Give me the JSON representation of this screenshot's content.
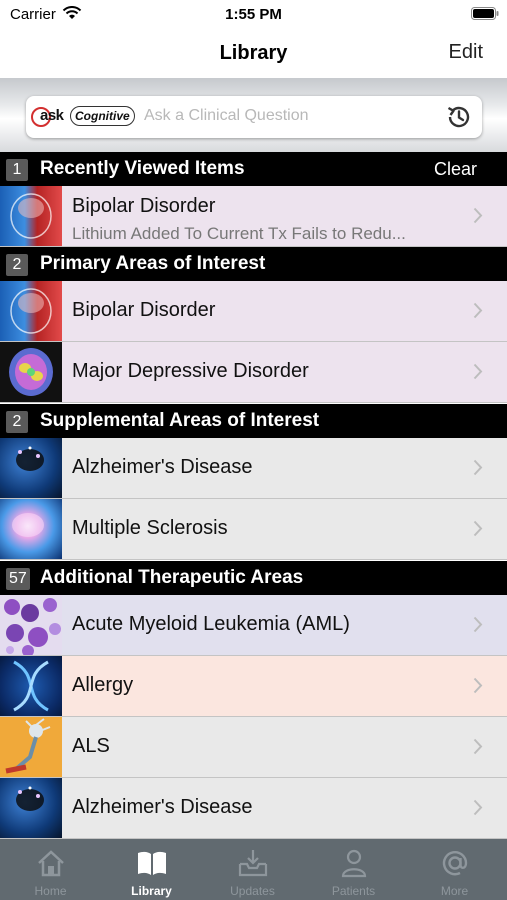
{
  "status_bar": {
    "carrier": "Carrier",
    "time": "1:55 PM"
  },
  "nav": {
    "title": "Library",
    "edit_label": "Edit"
  },
  "search": {
    "logo_ask": "ask",
    "logo_cognitive": "Cognitive",
    "placeholder": "Ask a Clinical Question"
  },
  "sections": [
    {
      "count": "1",
      "title": "Recently Viewed Items",
      "action": "Clear",
      "items": [
        {
          "title": "Bipolar Disorder",
          "subtitle": "Lithium Added To Current Tx Fails to Redu...",
          "icon": "brain-red-icon"
        }
      ]
    },
    {
      "count": "2",
      "title": "Primary Areas of Interest",
      "items": [
        {
          "title": "Bipolar Disorder",
          "icon": "brain-red-icon"
        },
        {
          "title": "Major Depressive Disorder",
          "icon": "brain-scan-icon"
        }
      ]
    },
    {
      "count": "2",
      "title": "Supplemental Areas of Interest",
      "items": [
        {
          "title": "Alzheimer's Disease",
          "icon": "head-blue-icon"
        },
        {
          "title": "Multiple Sclerosis",
          "icon": "brain-glow-icon"
        }
      ]
    },
    {
      "count": "57",
      "title": "Additional Therapeutic Areas",
      "items": [
        {
          "title": "Acute Myeloid Leukemia (AML)",
          "icon": "cells-icon"
        },
        {
          "title": "Allergy",
          "icon": "dna-icon"
        },
        {
          "title": "ALS",
          "icon": "neuron-icon"
        },
        {
          "title": "Alzheimer's Disease",
          "icon": "head-blue-icon"
        }
      ]
    }
  ],
  "tabs": [
    {
      "label": "Home",
      "icon": "home-icon",
      "active": false
    },
    {
      "label": "Library",
      "icon": "book-icon",
      "active": true
    },
    {
      "label": "Updates",
      "icon": "inbox-download-icon",
      "active": false
    },
    {
      "label": "Patients",
      "icon": "person-icon",
      "active": false
    },
    {
      "label": "More",
      "icon": "at-sign-icon",
      "active": false
    }
  ],
  "colors": {
    "section_header_bg": "#000000",
    "row_purple": "#ede3ee",
    "row_gray": "#e9e9e9",
    "row_lavender": "#e1e0ee",
    "row_peach": "#fbe6df",
    "tab_bar_bg": "#616a70"
  }
}
